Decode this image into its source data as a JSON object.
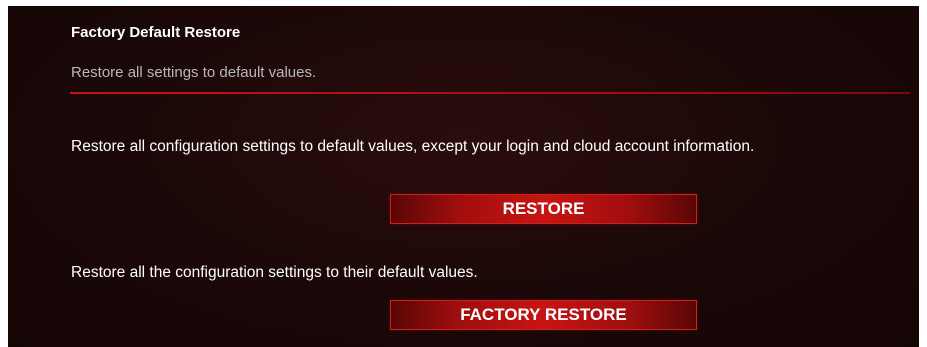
{
  "section": {
    "title": "Factory Default Restore",
    "description": "Restore all settings to default values."
  },
  "restore": {
    "text": "Restore all configuration settings to default values, except your login and cloud account information.",
    "button_label": "RESTORE"
  },
  "factory_restore": {
    "text": "Restore all the configuration settings to their default values.",
    "button_label": "FACTORY RESTORE"
  },
  "colors": {
    "panel_background": "#1b0808",
    "accent_red": "#c41414",
    "heading_text": "#ffffff",
    "muted_text": "#b8b8b8"
  }
}
